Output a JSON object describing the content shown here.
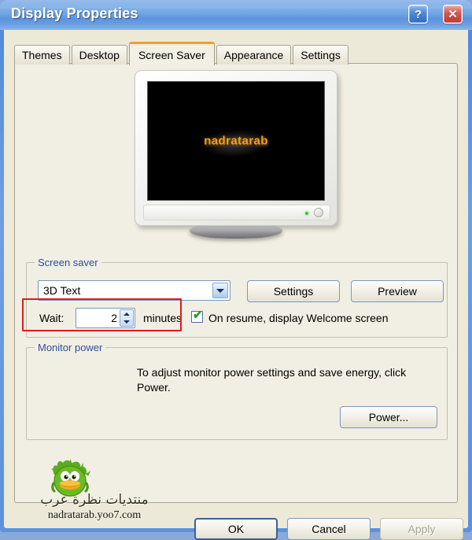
{
  "window": {
    "title": "Display Properties",
    "help_button": "?",
    "close_button": "✕"
  },
  "tabs": [
    {
      "label": "Themes",
      "active": false
    },
    {
      "label": "Desktop",
      "active": false
    },
    {
      "label": "Screen Saver",
      "active": true
    },
    {
      "label": "Appearance",
      "active": false
    },
    {
      "label": "Settings",
      "active": false
    }
  ],
  "preview": {
    "screensaver_text": "nadratarab",
    "text_color": "#f0a023",
    "screen_background": "#000000"
  },
  "screen_saver_group": {
    "title": "Screen saver",
    "combo_value": "3D Text",
    "settings_button": "Settings",
    "preview_button": "Preview",
    "wait_label": "Wait:",
    "wait_value": "2",
    "minutes_label": "minutes",
    "on_resume_checked": true,
    "on_resume_label": "On resume, display Welcome screen"
  },
  "monitor_power_group": {
    "title": "Monitor power",
    "description": "To adjust monitor power settings and save energy, click Power.",
    "power_button": "Power..."
  },
  "footer": {
    "ok_button": "OK",
    "cancel_button": "Cancel",
    "apply_button": "Apply",
    "apply_enabled": false
  },
  "watermark": {
    "arabic_text": "منتديات نظرة عرب",
    "url": "nadratarab.yoo7.com"
  },
  "annotation": {
    "color": "#e01b1b",
    "target": "wait-spinner-area"
  }
}
